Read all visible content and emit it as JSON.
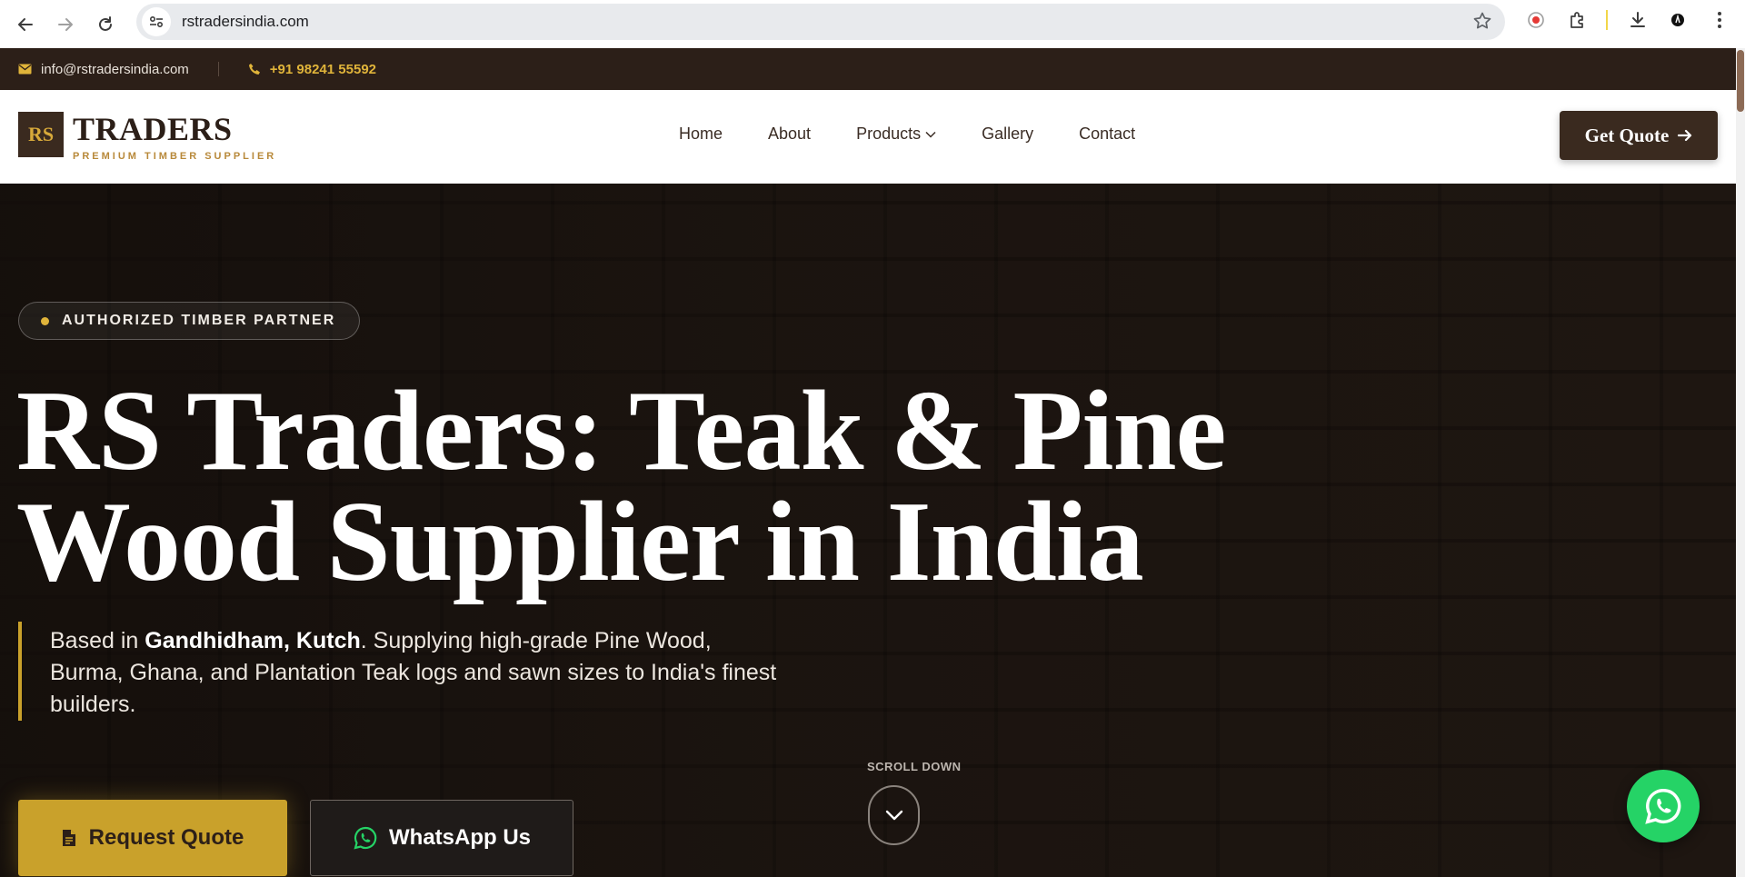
{
  "browser": {
    "url": "rstradersindia.com"
  },
  "topbar": {
    "email": "info@rstradersindia.com",
    "phone": "+91 98241 55592"
  },
  "header": {
    "logo_mark": "RS",
    "logo_name": "TRADERS",
    "logo_tagline": "PREMIUM TIMBER SUPPLIER",
    "menu": [
      {
        "label": "Home"
      },
      {
        "label": "About"
      },
      {
        "label": "Products"
      },
      {
        "label": "Gallery"
      },
      {
        "label": "Contact"
      }
    ],
    "cta_label": "Get Quote"
  },
  "hero": {
    "badge": "AUTHORIZED TIMBER PARTNER",
    "headline_line1": "RS Traders: Teak & Pine",
    "headline_line2": "Wood Supplier in India",
    "sub_prefix": "Based in ",
    "sub_strong": "Gandhidham, Kutch",
    "sub_rest": ". Supplying high-grade Pine Wood, Burma, Ghana, and Plantation Teak logs and sawn sizes to India's finest builders.",
    "btn_quote": "Request Quote",
    "btn_whatsapp": "WhatsApp Us",
    "scroll_label": "SCROLL DOWN"
  },
  "colors": {
    "brand_dark": "#2c1f18",
    "accent_gold": "#c9a12b",
    "whatsapp_green": "#25d366"
  },
  "icons": {
    "email": "envelope-icon",
    "phone": "phone-icon",
    "quote": "document-icon",
    "whatsapp": "whatsapp-icon",
    "scroll": "chevron-down-icon"
  }
}
